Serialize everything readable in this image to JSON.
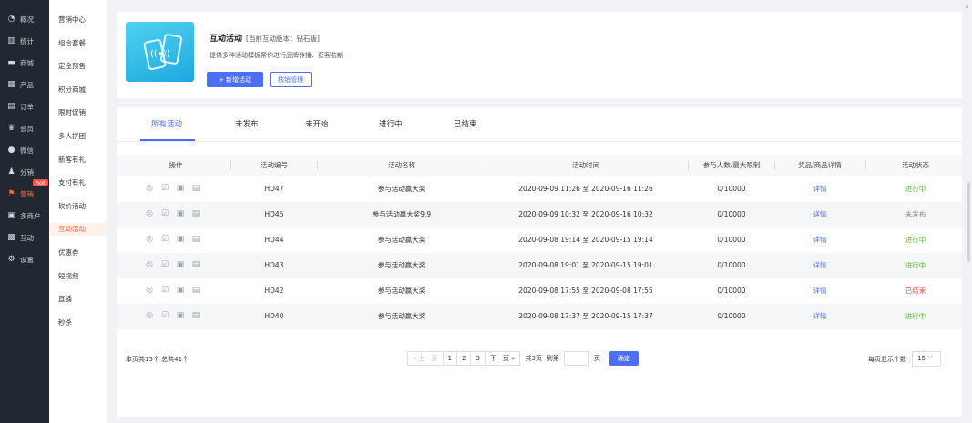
{
  "sidebar": {
    "items": [
      {
        "label": "概况",
        "icon": "dashboard-icon",
        "glyph": "◔"
      },
      {
        "label": "统计",
        "icon": "stats-icon",
        "glyph": "▥"
      },
      {
        "label": "商城",
        "icon": "shop-icon",
        "glyph": "▬"
      },
      {
        "label": "产品",
        "icon": "product-icon",
        "glyph": "▦"
      },
      {
        "label": "订单",
        "icon": "order-icon",
        "glyph": "▤"
      },
      {
        "label": "会员",
        "icon": "member-icon",
        "glyph": "♛"
      },
      {
        "label": "微信",
        "icon": "wechat-icon",
        "glyph": "●"
      },
      {
        "label": "分销",
        "icon": "distribution-icon",
        "glyph": "♟"
      },
      {
        "label": "营销",
        "icon": "marketing-icon",
        "glyph": "⚑",
        "badge": "hot",
        "active": true
      },
      {
        "label": "多商户",
        "icon": "merchant-icon",
        "glyph": "▣"
      },
      {
        "label": "互动",
        "icon": "interact-icon",
        "glyph": "▩"
      },
      {
        "label": "设置",
        "icon": "settings-icon",
        "glyph": "⚙"
      }
    ]
  },
  "submenu": {
    "items": [
      "营销中心",
      "组合套餐",
      "定金预售",
      "积分商城",
      "限时促销",
      "多人拼团",
      "新客有礼",
      "支付有礼",
      "砍价活动",
      "互动活动",
      "优惠券",
      "短视频",
      "直播",
      "秒杀"
    ],
    "active_index": 9
  },
  "header": {
    "title": "互动活动",
    "version": "[当前互动版本：钻石版]",
    "description": "提供多种活动模板帮你进行品牌传播、获客拉新",
    "new_button": "+ 新增活动",
    "verify_button": "核销管理"
  },
  "tabs": [
    "所有活动",
    "未发布",
    "未开始",
    "进行中",
    "已结束"
  ],
  "table": {
    "columns": [
      "操作",
      "活动编号",
      "活动名称",
      "活动时间",
      "参与人数/最大限制",
      "奖品/商品详情",
      "活动状态"
    ],
    "rows": [
      {
        "id": "HD47",
        "name": "参与活动赢大奖",
        "time": "2020-09-09 11:26 至 2020-09-16 11:26",
        "limit": "0/10000",
        "detail": "详情",
        "status": "进行中",
        "status_type": "green"
      },
      {
        "id": "HD45",
        "name": "参与活动赢大奖9.9",
        "time": "2020-09-09 10:32 至 2020-09-16 10:32",
        "limit": "0/10000",
        "detail": "详情",
        "status": "未发布",
        "status_type": "gray"
      },
      {
        "id": "HD44",
        "name": "参与活动赢大奖",
        "time": "2020-09-08 19:14 至 2020-09-15 19:14",
        "limit": "0/10000",
        "detail": "详情",
        "status": "进行中",
        "status_type": "green"
      },
      {
        "id": "HD43",
        "name": "参与活动赢大奖",
        "time": "2020-09-08 19:01 至 2020-09-15 19:01",
        "limit": "0/10000",
        "detail": "详情",
        "status": "进行中",
        "status_type": "green"
      },
      {
        "id": "HD42",
        "name": "参与活动赢大奖",
        "time": "2020-09-08 17:55 至 2020-09-08 17:55",
        "limit": "0/10000",
        "detail": "详情",
        "status": "已结束",
        "status_type": "red"
      },
      {
        "id": "HD40",
        "name": "参与活动赢大奖",
        "time": "2020-09-08 17:37 至 2020-09-15 17:37",
        "limit": "0/10000",
        "detail": "详情",
        "status": "进行中",
        "status_type": "green"
      }
    ],
    "op_icons": [
      "view-icon",
      "edit-icon",
      "data-icon",
      "delete-icon"
    ]
  },
  "pagination": {
    "summary": "本页共15个 总共41个",
    "prev": "« 上一页",
    "pages": [
      "1",
      "2",
      "3"
    ],
    "next": "下一页 »",
    "total_pages": "共3页",
    "goto_label": "到第",
    "page_unit": "页",
    "confirm": "确定",
    "page_size_label": "每页显示个数",
    "page_size": "15"
  },
  "colors": {
    "accent": "#4b6ef5",
    "sidebar_bg": "#222831",
    "active_orange": "#ff6a3d"
  }
}
